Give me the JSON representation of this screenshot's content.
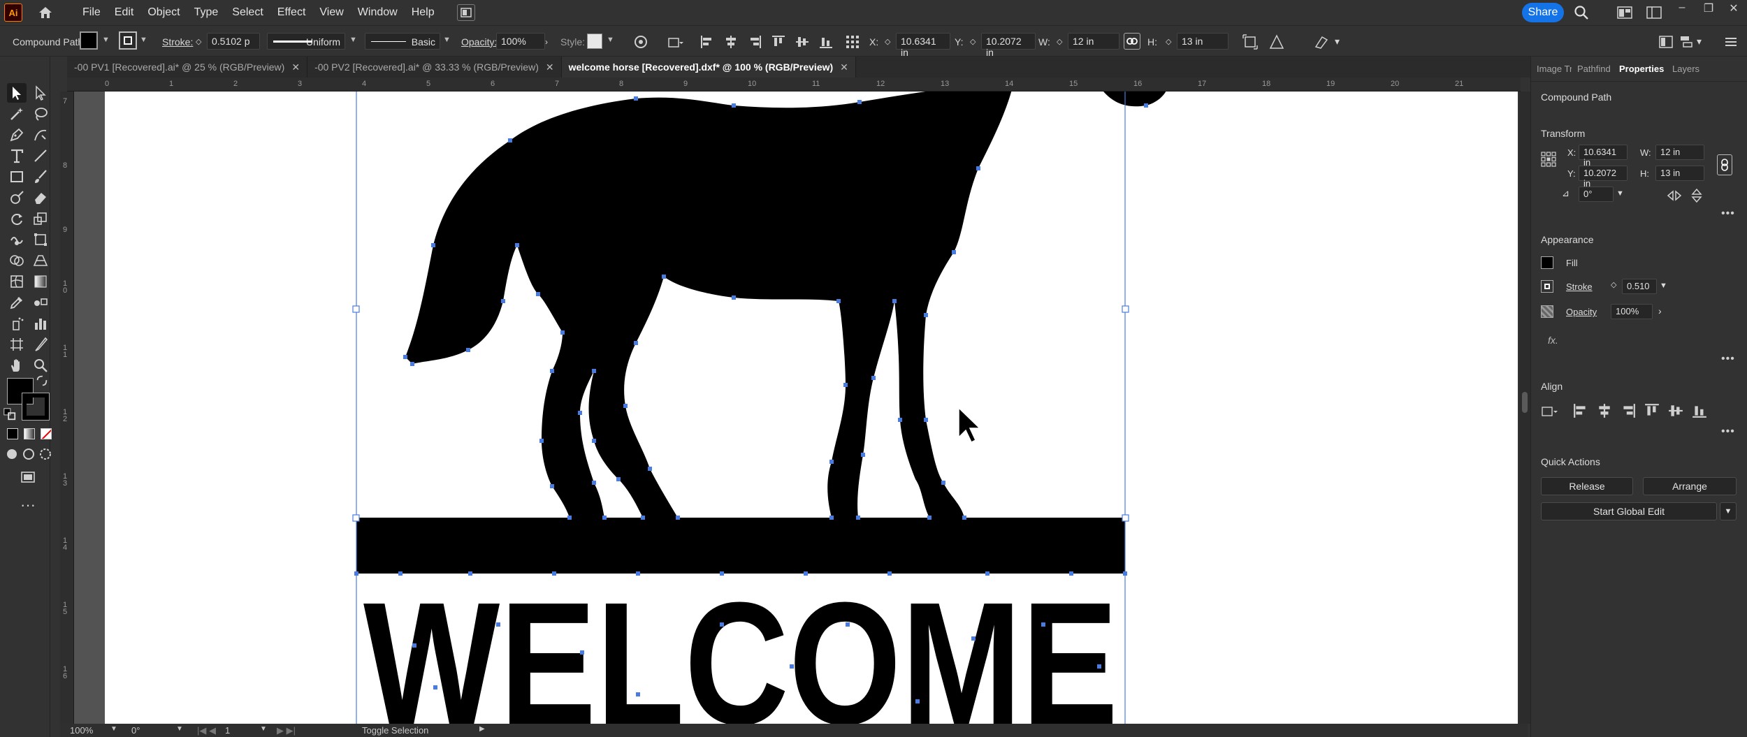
{
  "app": {
    "logo": "Ai"
  },
  "menu": [
    "File",
    "Edit",
    "Object",
    "Type",
    "Select",
    "Effect",
    "View",
    "Window",
    "Help"
  ],
  "topbar": {
    "share_label": "Share"
  },
  "control": {
    "selection_type": "Compound Path",
    "stroke_label": "Stroke:",
    "stroke_value": "0.5102 p",
    "profile_label": "Uniform",
    "brush_label": "Basic",
    "opacity_label": "Opacity:",
    "opacity_value": "100%",
    "style_label": "Style:",
    "x_label": "X:",
    "x_value": "10.6341 in",
    "y_label": "Y:",
    "y_value": "10.2072 in",
    "w_label": "W:",
    "w_value": "12 in",
    "h_label": "H:",
    "h_value": "13 in"
  },
  "tabs": [
    {
      "label": "-00 PV1 [Recovered].ai* @ 25 % (RGB/Preview)",
      "active": false
    },
    {
      "label": "-00 PV2 [Recovered].ai* @ 33.33 % (RGB/Preview)",
      "active": false
    },
    {
      "label": "welcome horse [Recovered].dxf* @ 100 % (RGB/Preview)",
      "active": true
    }
  ],
  "ruler": {
    "h": [
      "0",
      "1",
      "2",
      "3",
      "4",
      "5",
      "6",
      "7",
      "8",
      "9",
      "10",
      "11",
      "12",
      "13",
      "14",
      "15",
      "16",
      "17",
      "18",
      "19",
      "20",
      "21"
    ],
    "v": [
      "7",
      "8",
      "9",
      "1 0",
      "1 1",
      "1 2",
      "1 3",
      "1 4",
      "1 5",
      "1 6"
    ]
  },
  "artwork": {
    "text": "WELCOME"
  },
  "status": {
    "zoom": "100%",
    "rotation": "0°",
    "artboard": "1",
    "tool_hint": "Toggle Selection"
  },
  "panel": {
    "tabs": [
      "Image Tr",
      "Pathfind",
      "Properties",
      "Layers"
    ],
    "object_type": "Compound Path",
    "transform": {
      "title": "Transform",
      "x_label": "X:",
      "x_value": "10.6341 in",
      "y_label": "Y:",
      "y_value": "10.2072 in",
      "w_label": "W:",
      "w_value": "12 in",
      "h_label": "H:",
      "h_value": "13 in",
      "angle_value": "0°"
    },
    "appearance": {
      "title": "Appearance",
      "fill_label": "Fill",
      "stroke_label": "Stroke",
      "stroke_value": "0.510",
      "opacity_label": "Opacity",
      "opacity_value": "100%",
      "fx_label": "fx."
    },
    "align": {
      "title": "Align"
    },
    "quick_actions": {
      "title": "Quick Actions",
      "release": "Release",
      "arrange": "Arrange",
      "global_edit": "Start Global Edit"
    }
  },
  "colors": {
    "accent": "#1473e6",
    "selection": "#4a7bde",
    "ui_bg": "#323232",
    "artboard": "#ffffff"
  }
}
